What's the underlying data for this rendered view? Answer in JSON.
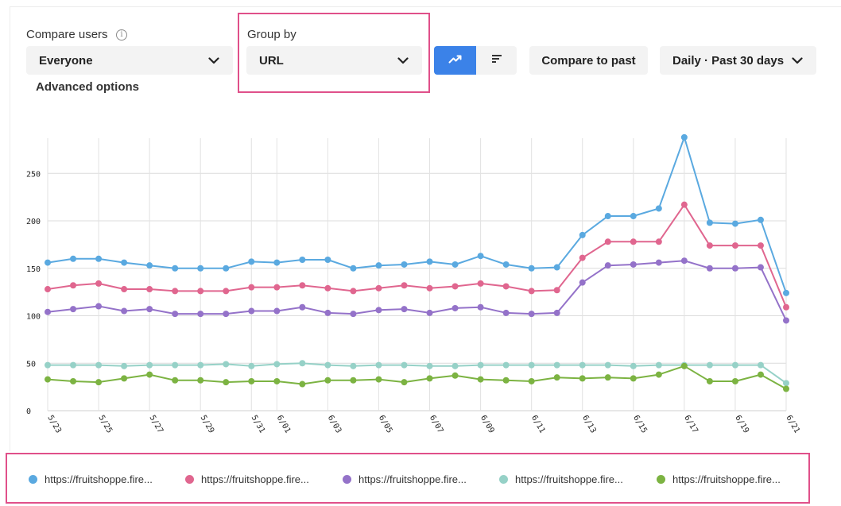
{
  "controls": {
    "compare_users_label": "Compare users",
    "compare_users_value": "Everyone",
    "group_by_label": "Group by",
    "group_by_value": "URL",
    "compare_to_past": "Compare to past",
    "date_range": "Daily · Past 30 days",
    "advanced_options": "Advanced options",
    "info_glyph": "i",
    "view_toggle": {
      "active": "line-chart-icon",
      "inactive": "bar-list-icon",
      "active_color": "#3b82e8"
    }
  },
  "highlight_color": "#e0508a",
  "chart_data": {
    "type": "line",
    "title": "",
    "xlabel": "",
    "ylabel": "",
    "ylim": [
      0,
      280
    ],
    "yticks": [
      0,
      50,
      100,
      150,
      200,
      250
    ],
    "grid": true,
    "legend_position": "bottom",
    "x": [
      "5/23",
      "5/24",
      "5/25",
      "5/26",
      "5/27",
      "5/28",
      "5/29",
      "5/30",
      "5/31",
      "6/01",
      "6/02",
      "6/03",
      "6/04",
      "6/05",
      "6/06",
      "6/07",
      "6/08",
      "6/09",
      "6/10",
      "6/11",
      "6/12",
      "6/13",
      "6/14",
      "6/15",
      "6/16",
      "6/17",
      "6/18",
      "6/19",
      "6/20",
      "6/21"
    ],
    "xtick_labels": [
      "5/23",
      "5/25",
      "5/27",
      "5/29",
      "5/31",
      "6/01",
      "6/03",
      "6/05",
      "6/07",
      "6/09",
      "6/11",
      "6/13",
      "6/15",
      "6/17",
      "6/19",
      "6/21"
    ],
    "series": [
      {
        "name": "https://fruitshoppe.fire...",
        "color": "#5aa9e0",
        "values": [
          156,
          160,
          160,
          156,
          153,
          150,
          150,
          150,
          157,
          156,
          159,
          159,
          150,
          153,
          154,
          157,
          154,
          163,
          154,
          150,
          151,
          185,
          205,
          205,
          213,
          288,
          198,
          197,
          201,
          124
        ]
      },
      {
        "name": "https://fruitshoppe.fire...",
        "color": "#e0668f",
        "values": [
          128,
          132,
          134,
          128,
          128,
          126,
          126,
          126,
          130,
          130,
          132,
          129,
          126,
          129,
          132,
          129,
          131,
          134,
          131,
          126,
          127,
          161,
          178,
          178,
          178,
          217,
          174,
          174,
          174,
          109
        ]
      },
      {
        "name": "https://fruitshoppe.fire...",
        "color": "#9472c9",
        "values": [
          104,
          107,
          110,
          105,
          107,
          102,
          102,
          102,
          105,
          105,
          109,
          103,
          102,
          106,
          107,
          103,
          108,
          109,
          103,
          102,
          103,
          135,
          153,
          154,
          156,
          158,
          150,
          150,
          151,
          95
        ]
      },
      {
        "name": "https://fruitshoppe.fire...",
        "color": "#96d1c7",
        "values": [
          48,
          48,
          48,
          47,
          48,
          48,
          48,
          49,
          47,
          49,
          50,
          48,
          47,
          48,
          48,
          47,
          47,
          48,
          48,
          48,
          48,
          48,
          48,
          47,
          48,
          48,
          48,
          48,
          48,
          29
        ]
      },
      {
        "name": "https://fruitshoppe.fire...",
        "color": "#7cb342",
        "values": [
          33,
          31,
          30,
          34,
          38,
          32,
          32,
          30,
          31,
          31,
          28,
          32,
          32,
          33,
          30,
          34,
          37,
          33,
          32,
          31,
          35,
          34,
          35,
          34,
          38,
          47,
          31,
          31,
          38,
          23
        ]
      }
    ]
  }
}
